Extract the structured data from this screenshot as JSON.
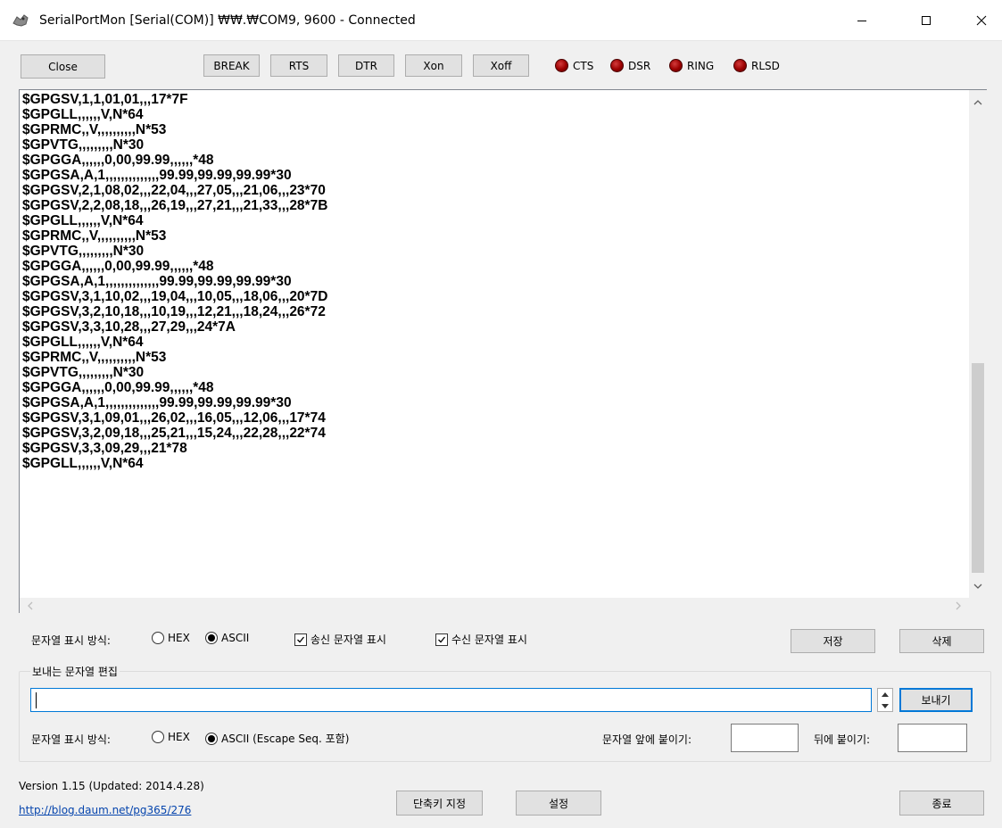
{
  "window": {
    "title": "SerialPortMon [Serial(COM)] ₩₩.₩COM9, 9600 - Connected"
  },
  "toolbar": {
    "close_label": "Close",
    "break_label": "BREAK",
    "rts_label": "RTS",
    "dtr_label": "DTR",
    "xon_label": "Xon",
    "xoff_label": "Xoff"
  },
  "indicators": {
    "cts": "CTS",
    "dsr": "DSR",
    "ring": "RING",
    "rlsd": "RLSD",
    "color": "#9b0000"
  },
  "output": {
    "lines": [
      "$GPGSV,1,1,01,01,,,17*7F",
      "$GPGLL,,,,,,V,N*64",
      "$GPRMC,,V,,,,,,,,,,N*53",
      "$GPVTG,,,,,,,,,N*30",
      "$GPGGA,,,,,,0,00,99.99,,,,,,*48",
      "$GPGSA,A,1,,,,,,,,,,,,,,99.99,99.99,99.99*30",
      "$GPGSV,2,1,08,02,,,22,04,,,27,05,,,21,06,,,23*70",
      "$GPGSV,2,2,08,18,,,26,19,,,27,21,,,21,33,,,28*7B",
      "$GPGLL,,,,,,V,N*64",
      "$GPRMC,,V,,,,,,,,,,N*53",
      "$GPVTG,,,,,,,,,N*30",
      "$GPGGA,,,,,,0,00,99.99,,,,,,*48",
      "$GPGSA,A,1,,,,,,,,,,,,,,99.99,99.99,99.99*30",
      "$GPGSV,3,1,10,02,,,19,04,,,10,05,,,18,06,,,20*7D",
      "$GPGSV,3,2,10,18,,,10,19,,,12,21,,,18,24,,,26*72",
      "$GPGSV,3,3,10,28,,,27,29,,,24*7A",
      "$GPGLL,,,,,,V,N*64",
      "$GPRMC,,V,,,,,,,,,,N*53",
      "$GPVTG,,,,,,,,,N*30",
      "$GPGGA,,,,,,0,00,99.99,,,,,,*48",
      "$GPGSA,A,1,,,,,,,,,,,,,,99.99,99.99,99.99*30",
      "$GPGSV,3,1,09,01,,,26,02,,,16,05,,,12,06,,,17*74",
      "$GPGSV,3,2,09,18,,,25,21,,,15,24,,,22,28,,,22*74",
      "$GPGSV,3,3,09,29,,,21*78",
      "$GPGLL,,,,,,V,N*64"
    ]
  },
  "display_options": {
    "mode_label": "문자열 표시 방식:",
    "hex_label": "HEX",
    "ascii_label": "ASCII",
    "selected": "ASCII",
    "show_sent_label": "송신 문자열 표시",
    "show_sent_checked": true,
    "show_received_label": "수신 문자열 표시",
    "show_received_checked": true,
    "save_label": "저장",
    "delete_label": "삭제"
  },
  "send": {
    "group_title": "보내는 문자열 편집",
    "input_value": "",
    "send_label": "보내기",
    "mode_label": "문자열 표시 방식:",
    "hex_label": "HEX",
    "ascii_label": "ASCII (Escape Seq. 포함)",
    "selected": "ASCII",
    "prefix_label": "문자열 앞에 붙이기:",
    "prefix_value": "",
    "suffix_label": "뒤에 붙이기:",
    "suffix_value": ""
  },
  "footer": {
    "version": "Version 1.15 (Updated: 2014.4.28)",
    "link": "http://blog.daum.net/pg365/276",
    "shortcut_label": "단축키 지정",
    "settings_label": "설정",
    "exit_label": "종료"
  }
}
